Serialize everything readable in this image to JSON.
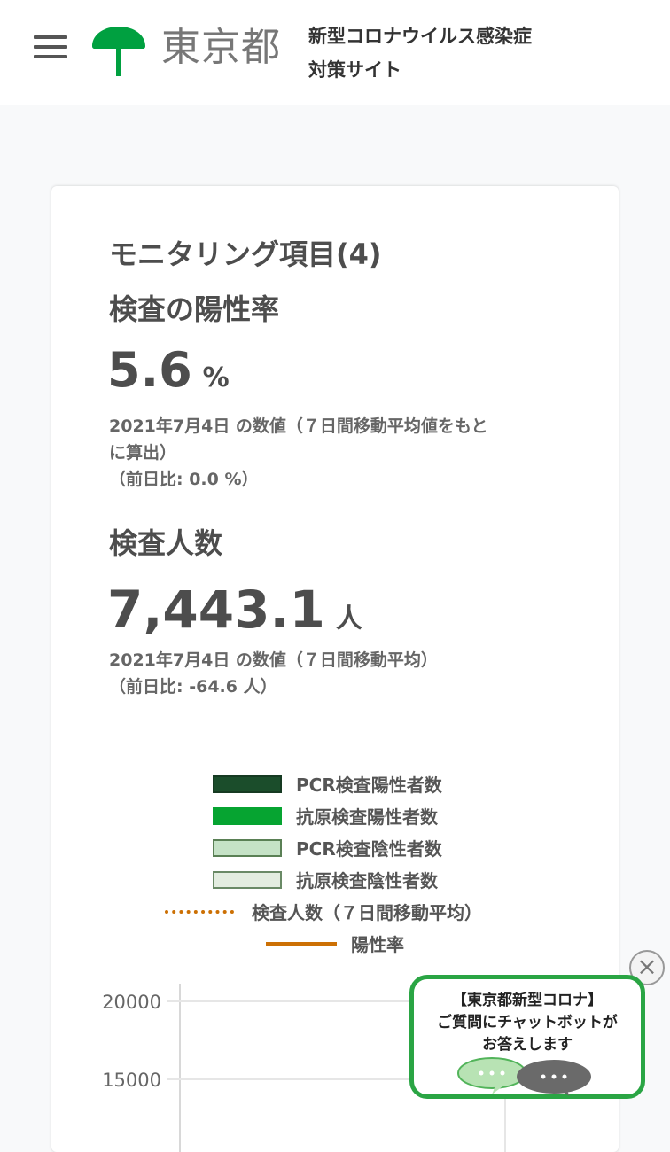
{
  "header": {
    "logo_text": "東京都",
    "site_title_line1": "新型コロナウイルス感染症",
    "site_title_line2": "対策サイト"
  },
  "card": {
    "title": "モニタリング項目(4)",
    "positivity": {
      "heading": "検査の陽性率",
      "value": "5.6",
      "unit": "%",
      "note_line1": "2021年7月4日 の数値（７日間移動平均値をもと",
      "note_line2": "に算出）",
      "note_line3": "（前日比: 0.0 %）"
    },
    "tests": {
      "heading": "検査人数",
      "value": "7,443.1",
      "unit": "人",
      "note_line1": "2021年7月4日 の数値（７日間移動平均）",
      "note_line2": "（前日比: -64.6 人）"
    },
    "legend": [
      {
        "label": "PCR検査陽性者数",
        "color": "#1b4d2b",
        "style": "box"
      },
      {
        "label": "抗原検査陽性者数",
        "color": "#06a431",
        "style": "box"
      },
      {
        "label": "PCR検査陰性者数",
        "color": "#c5e2c6",
        "style": "box"
      },
      {
        "label": "抗原検査陰性者数",
        "color": "#e3ede0",
        "style": "box"
      },
      {
        "label": "検査人数（７日間移動平均）",
        "color": "#cc7004",
        "style": "dotted"
      },
      {
        "label": "陽性率",
        "color": "#cc7004",
        "style": "line"
      }
    ]
  },
  "chart_data": {
    "type": "bar",
    "y_ticks": [
      "20000",
      "15000"
    ],
    "ylim": [
      10000,
      20000
    ],
    "grid": true
  },
  "chatbot": {
    "line1": "【東京都新型コロナ】",
    "line2": "ご質問にチャットボットが",
    "line3": "お答えします",
    "close_label": "×"
  },
  "colors": {
    "brand_green": "#00a040",
    "chatbot_border": "#2aa544",
    "accent_orange": "#cc7004"
  }
}
